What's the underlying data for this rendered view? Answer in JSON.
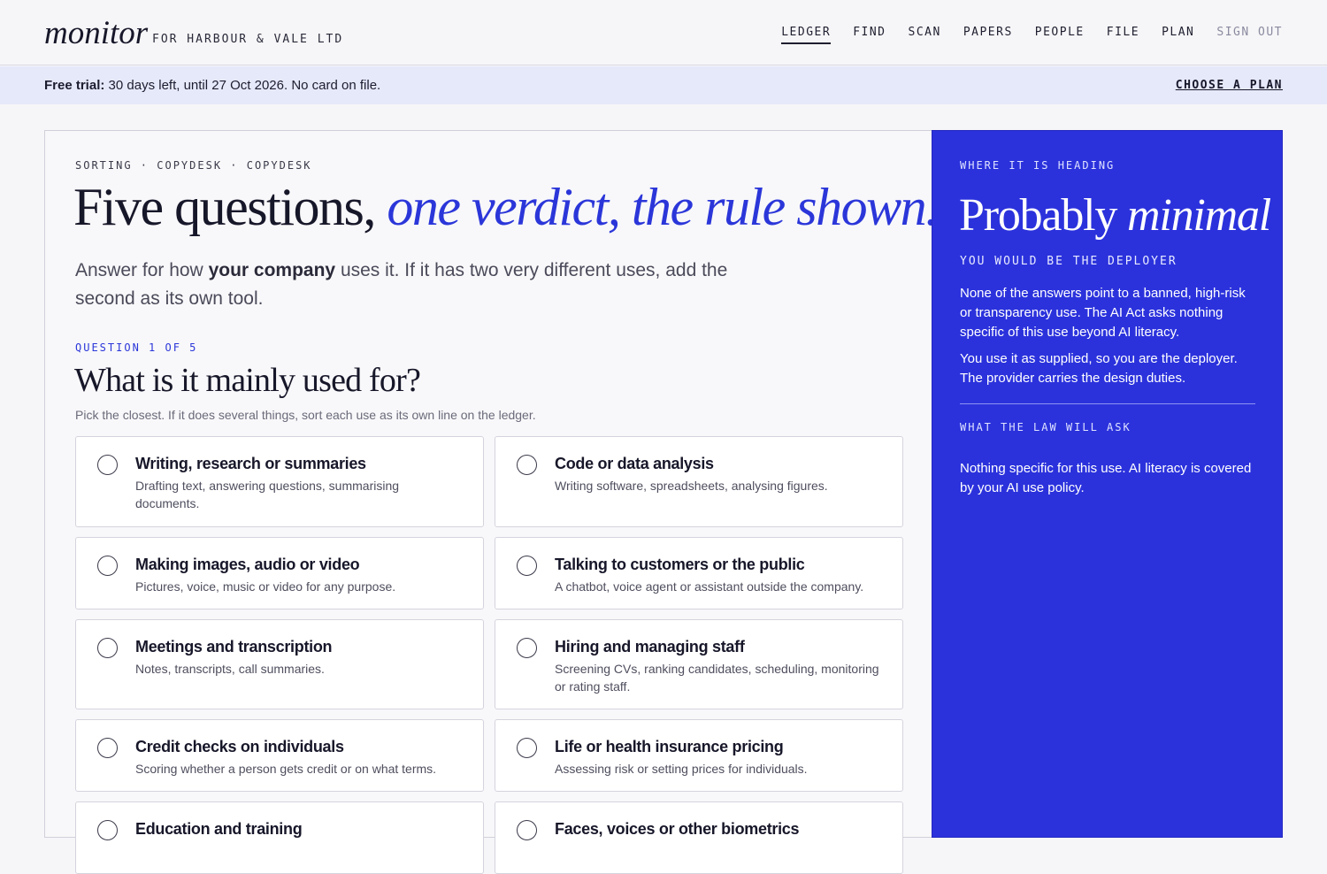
{
  "header": {
    "logo": "monitor",
    "org": "FOR HARBOUR & VALE LTD",
    "nav": [
      {
        "label": "LEDGER",
        "active": true
      },
      {
        "label": "FIND"
      },
      {
        "label": "SCAN"
      },
      {
        "label": "PAPERS"
      },
      {
        "label": "PEOPLE"
      },
      {
        "label": "FILE"
      },
      {
        "label": "PLAN"
      },
      {
        "label": "SIGN OUT",
        "muted": true
      }
    ]
  },
  "trial": {
    "label": "Free trial:",
    "text": " 30 days left, until 27 Oct 2026. No card on file.",
    "link": "CHOOSE A PLAN"
  },
  "main": {
    "crumb": "SORTING · COPYDESK · COPYDESK",
    "headline_plain": "Five questions, ",
    "headline_accent": "one verdict, the rule shown.",
    "intro_pre": "Answer for how ",
    "intro_bold": "your company",
    "intro_post": " uses it. If it has two very different uses, add the second as its own tool.",
    "question_label": "QUESTION 1 OF 5",
    "question_title": "What is it mainly used for?",
    "question_hint": "Pick the closest. If it does several things, sort each use as its own line on the ledger.",
    "options": [
      {
        "title": "Writing, research or summaries",
        "desc": "Drafting text, answering questions, summarising documents."
      },
      {
        "title": "Code or data analysis",
        "desc": "Writing software, spreadsheets, analysing figures."
      },
      {
        "title": "Making images, audio or video",
        "desc": "Pictures, voice, music or video for any purpose."
      },
      {
        "title": "Talking to customers or the public",
        "desc": "A chatbot, voice agent or assistant outside the company."
      },
      {
        "title": "Meetings and transcription",
        "desc": "Notes, transcripts, call summaries."
      },
      {
        "title": "Hiring and managing staff",
        "desc": "Screening CVs, ranking candidates, scheduling, monitoring or rating staff."
      },
      {
        "title": "Credit checks on individuals",
        "desc": "Scoring whether a person gets credit or on what terms."
      },
      {
        "title": "Life or health insurance pricing",
        "desc": "Assessing risk or setting prices for individuals."
      },
      {
        "title": "Education and training",
        "desc": ""
      },
      {
        "title": "Faces, voices or other biometrics",
        "desc": ""
      }
    ]
  },
  "side": {
    "eyebrow": "WHERE IT IS HEADING",
    "verdict_plain": "Probably ",
    "verdict_italic": "minimal",
    "role": "YOU WOULD BE THE DEPLOYER",
    "p1": "None of the answers point to a banned, high-risk or transparency use. The AI Act asks nothing specific of this use beyond AI literacy.",
    "p2": "You use it as supplied, so you are the deployer. The provider carries the design duties.",
    "law_label": "WHAT THE LAW WILL ASK",
    "law_text": "Nothing specific for this use. AI literacy is covered by your AI use policy."
  },
  "colors": {
    "accent": "#2b36d9",
    "panel": "#2b32dc",
    "banner": "#e6e9fa"
  }
}
